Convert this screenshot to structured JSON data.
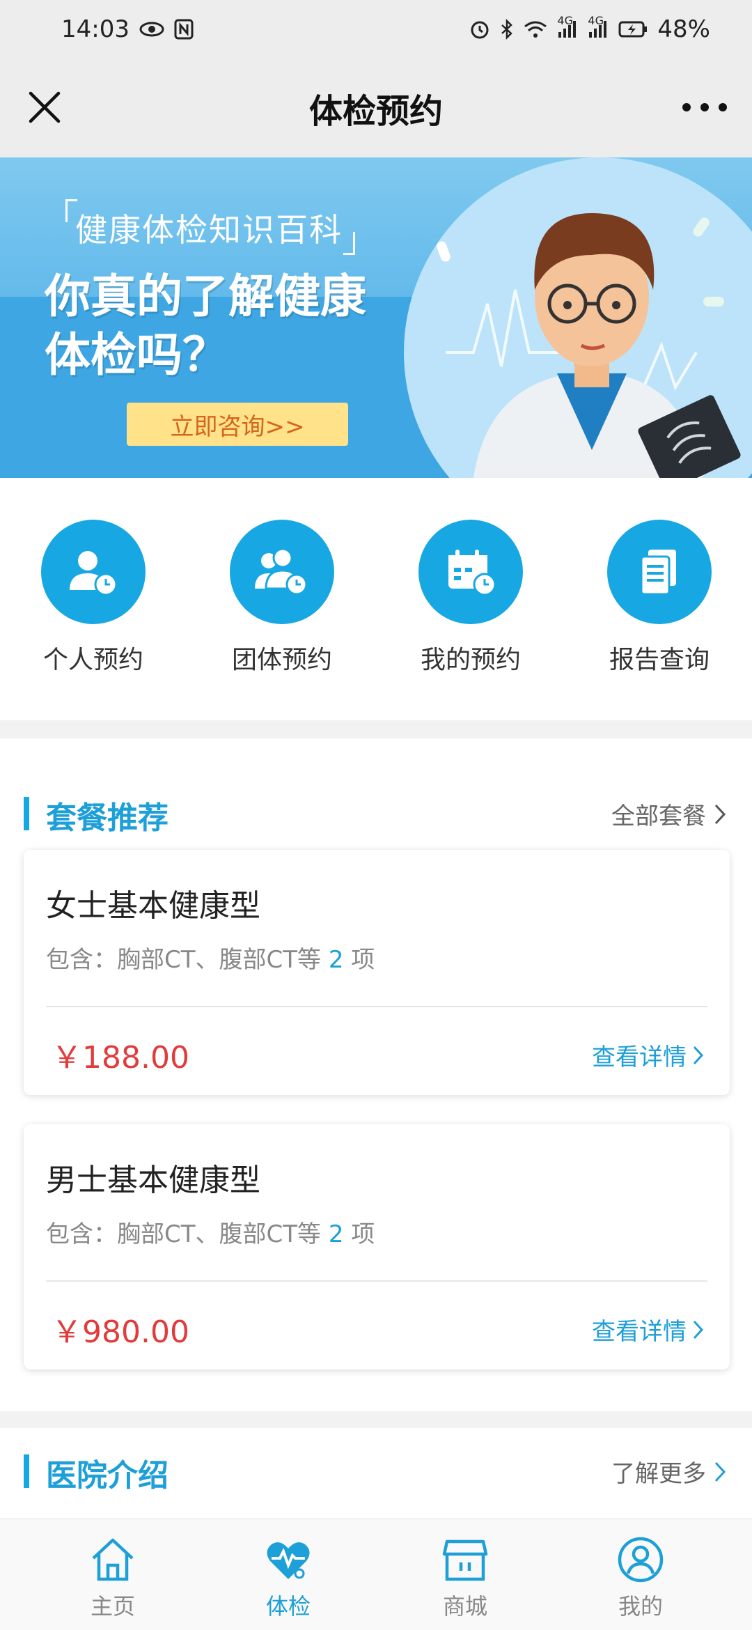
{
  "status_bar": {
    "time": "14:03",
    "battery": "48%",
    "network_a": "4G",
    "network_b": "4G"
  },
  "nav": {
    "title": "体检预约"
  },
  "banner": {
    "subtitle": "健康体检知识百科",
    "headline_1": "你真的了解健康",
    "headline_2": "体检吗？",
    "button": "立即咨询>>"
  },
  "quick_actions": [
    {
      "label": "个人预约",
      "icon": "person-clock-icon"
    },
    {
      "label": "团体预约",
      "icon": "group-clock-icon"
    },
    {
      "label": "我的预约",
      "icon": "calendar-clock-icon"
    },
    {
      "label": "报告查询",
      "icon": "documents-icon"
    }
  ],
  "packages_section": {
    "title": "套餐推荐",
    "more": "全部套餐"
  },
  "packages": [
    {
      "name": "女士基本健康型",
      "desc_prefix": "包含：胸部CT、腹部CT等",
      "count": "2",
      "desc_suffix": "项",
      "price": "￥188.00",
      "detail": "查看详情"
    },
    {
      "name": "男士基本健康型",
      "desc_prefix": "包含：胸部CT、腹部CT等",
      "count": "2",
      "desc_suffix": "项",
      "price": "￥980.00",
      "detail": "查看详情"
    }
  ],
  "hospital_section": {
    "title": "医院介绍",
    "more": "了解更多"
  },
  "tabs": [
    {
      "label": "主页",
      "icon": "home-icon",
      "active": false
    },
    {
      "label": "体检",
      "icon": "heart-pulse-icon",
      "active": true
    },
    {
      "label": "商城",
      "icon": "store-icon",
      "active": false
    },
    {
      "label": "我的",
      "icon": "user-circle-icon",
      "active": false
    }
  ],
  "colors": {
    "accent": "#17a7e2",
    "price": "#e23b3b",
    "banner_button": "#ffe28a"
  }
}
